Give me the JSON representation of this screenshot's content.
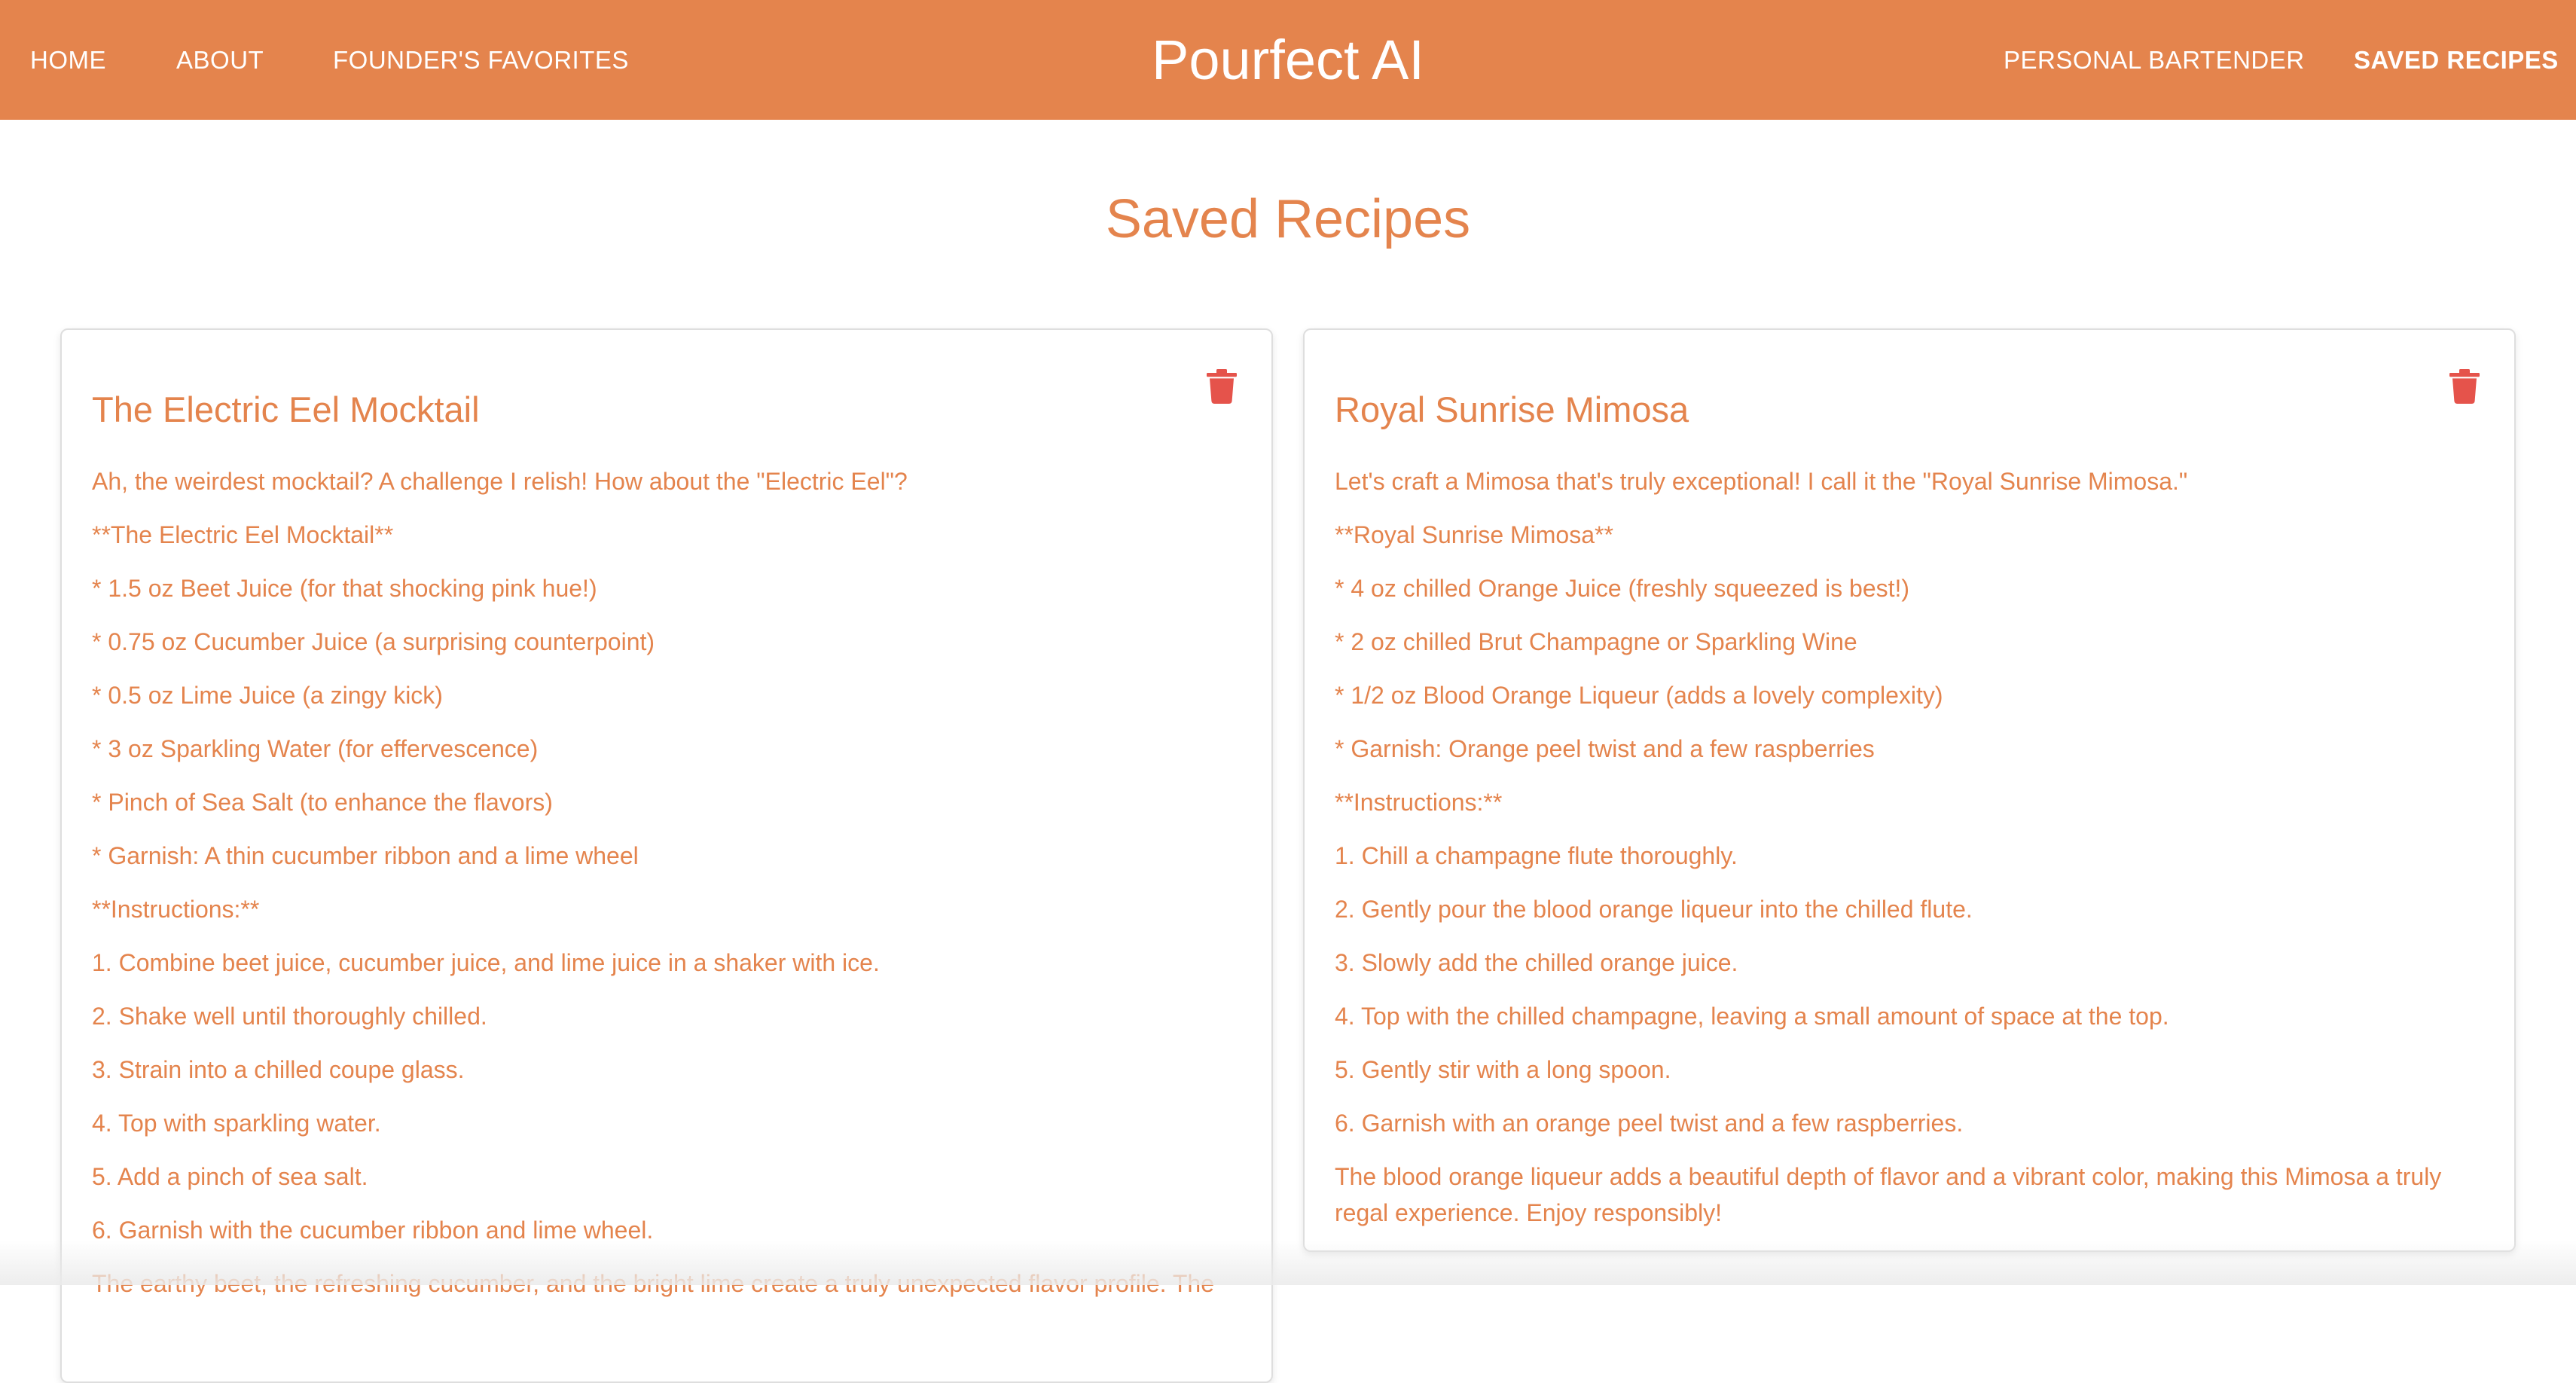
{
  "nav": {
    "brand": "Pourfect AI",
    "left_links": [
      "HOME",
      "ABOUT",
      "FOUNDER'S FAVORITES"
    ],
    "right_links": [
      "PERSONAL BARTENDER",
      "SAVED RECIPES"
    ],
    "active": "SAVED RECIPES"
  },
  "page": {
    "title": "Saved Recipes"
  },
  "recipes": [
    {
      "title": "The Electric Eel Mocktail",
      "delete_icon": "trash-icon",
      "lines": [
        "Ah, the weirdest mocktail? A challenge I relish! How about the \"Electric Eel\"?",
        "**The Electric Eel Mocktail**",
        "* 1.5 oz Beet Juice (for that shocking pink hue!)",
        "* 0.75 oz Cucumber Juice (a surprising counterpoint)",
        "* 0.5 oz Lime Juice (a zingy kick)",
        "* 3 oz Sparkling Water (for effervescence)",
        "* Pinch of Sea Salt (to enhance the flavors)",
        "* Garnish: A thin cucumber ribbon and a lime wheel",
        "**Instructions:**",
        "1. Combine beet juice, cucumber juice, and lime juice in a shaker with ice.",
        "2. Shake well until thoroughly chilled.",
        "3. Strain into a chilled coupe glass.",
        "4. Top with sparkling water.",
        "5. Add a pinch of sea salt.",
        "6. Garnish with the cucumber ribbon and lime wheel.",
        "The earthy beet, the refreshing cucumber, and the bright lime create a truly unexpected flavor profile. The"
      ]
    },
    {
      "title": "Royal Sunrise Mimosa",
      "delete_icon": "trash-icon",
      "lines": [
        "Let's craft a Mimosa that's truly exceptional! I call it the \"Royal Sunrise Mimosa.\"",
        "**Royal Sunrise Mimosa**",
        "* 4 oz chilled Orange Juice (freshly squeezed is best!)",
        "* 2 oz chilled Brut Champagne or Sparkling Wine",
        "* 1/2 oz Blood Orange Liqueur (adds a lovely complexity)",
        "* Garnish: Orange peel twist and a few raspberries",
        "**Instructions:**",
        "1. Chill a champagne flute thoroughly.",
        "2. Gently pour the blood orange liqueur into the chilled flute.",
        "3. Slowly add the chilled orange juice.",
        "4. Top with the chilled champagne, leaving a small amount of space at the top.",
        "5. Gently stir with a long spoon.",
        "6. Garnish with an orange peel twist and a few raspberries.",
        "The blood orange liqueur adds a beautiful depth of flavor and a vibrant color, making this Mimosa a truly regal experience. Enjoy responsibly!"
      ]
    }
  ],
  "colors": {
    "brand": "#E4844D",
    "delete": "#E5534B",
    "card_border": "#dedede"
  }
}
